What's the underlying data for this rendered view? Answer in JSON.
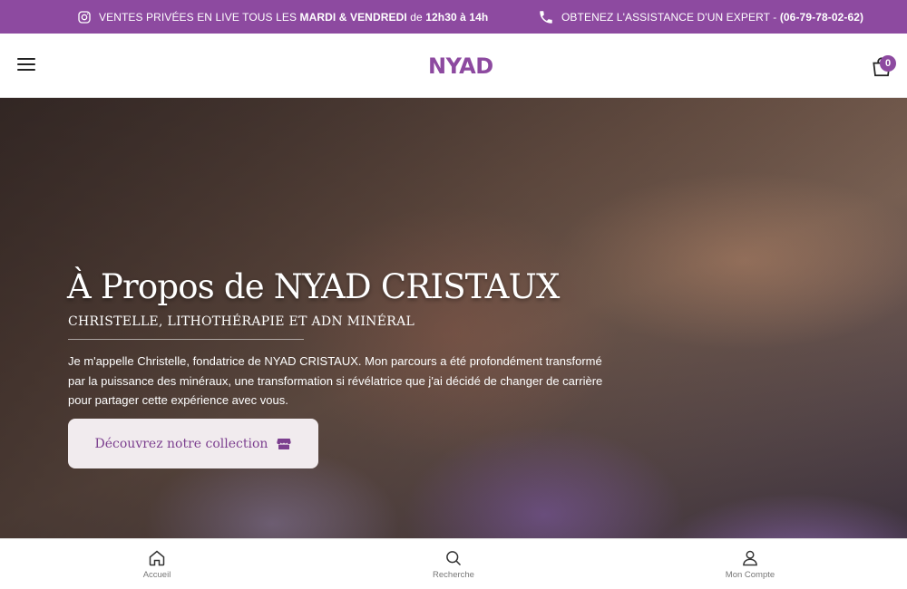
{
  "announcement": {
    "left_prefix": "VENTES PRIVÉES EN LIVE TOUS LES ",
    "left_days": "MARDI & VENDREDI",
    "left_mid": " de ",
    "left_time": "12h30 à 14h",
    "right_prefix": "OBTENEZ L'ASSISTANCE D'UN EXPERT - ",
    "right_phone": "(06-79-78-02-62)",
    "left_icon": "instagram-icon",
    "right_icon": "phone-icon"
  },
  "header": {
    "logo_text": "NYAD",
    "cart_count": "0",
    "menu_icon": "hamburger-icon",
    "cart_icon": "shopping-bag-icon"
  },
  "hero": {
    "title": "À Propos de NYAD CRISTAUX",
    "subtitle": "CHRISTELLE, LITHOTHÉRAPIE ET ADN MINÉRAL",
    "text": "Je m'appelle Christelle, fondatrice de NYAD CRISTAUX. Mon parcours a été profondément transformé par la puissance des minéraux, une transformation si révélatrice que j'ai décidé de changer de carrière pour partager cette expérience avec vous.",
    "button_label": "Découvrez notre collection",
    "button_icon": "store-icon"
  },
  "bottom_nav": {
    "items": [
      {
        "label": "Accueil",
        "icon": "home-icon"
      },
      {
        "label": "Recherche",
        "icon": "search-icon"
      },
      {
        "label": "Mon Compte",
        "icon": "user-icon"
      }
    ]
  },
  "colors": {
    "brand_purple": "#8d4aa0",
    "button_bg": "#f1ebee",
    "button_text": "#7c3f8f"
  }
}
